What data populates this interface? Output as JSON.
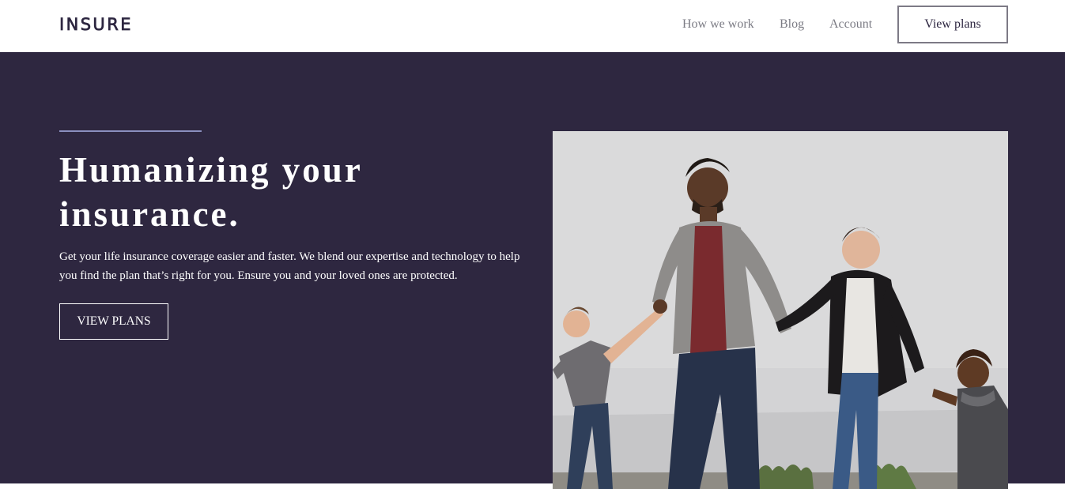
{
  "brand": {
    "logo_text": "INSURE"
  },
  "nav": {
    "links": [
      {
        "label": "How we work"
      },
      {
        "label": "Blog"
      },
      {
        "label": "Account"
      }
    ],
    "cta_label": "View plans"
  },
  "hero": {
    "title_line1": "Humanizing your",
    "title_line2": "insurance.",
    "description": "Get your life insurance coverage easier and faster. We blend our expertise and technology to help you find the plan that’s right for you. Ensure you and your loved ones are protected.",
    "cta_label": "VIEW PLANS",
    "image_alt": "Family of four holding hands and walking"
  },
  "colors": {
    "hero_bg": "#2e2740",
    "accent_line": "#8a8fbf",
    "header_bg": "#ffffff",
    "nav_text": "#7b7b84",
    "brand_dark": "#2d2640"
  }
}
